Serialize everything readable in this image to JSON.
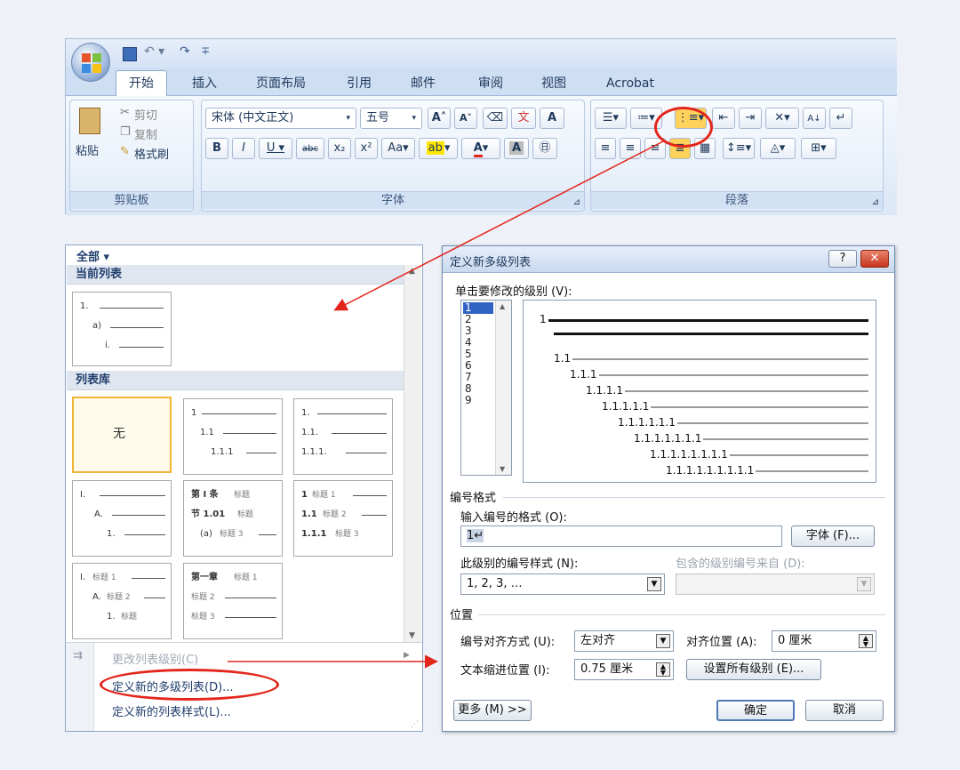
{
  "ribbon": {
    "tabs": [
      "开始",
      "插入",
      "页面布局",
      "引用",
      "邮件",
      "审阅",
      "视图",
      "Acrobat"
    ],
    "active_tab": "开始",
    "clipboard": {
      "paste": "粘贴",
      "cut": "剪切",
      "copy": "复制",
      "format_painter": "格式刷",
      "label": "剪贴板"
    },
    "font": {
      "name": "宋体 (中文正文)",
      "size": "五号",
      "label": "字体"
    },
    "paragraph": {
      "label": "段落"
    }
  },
  "list_panel": {
    "filter": "全部 ▾",
    "current_list_header": "当前列表",
    "library_header": "列表库",
    "none_label": "无",
    "current_tile": [
      "1.",
      "a)",
      "i."
    ],
    "tile2": [
      "1",
      "1.1",
      "1.1.1"
    ],
    "tile3": [
      "1.",
      "1.1.",
      "1.1.1."
    ],
    "tile4": [
      "I.",
      "A.",
      "1."
    ],
    "tile5": [
      "第 I 条",
      "标题",
      "节 1.01",
      "标题",
      "(a)",
      "标题 3"
    ],
    "tile6": [
      "1",
      "标题 1",
      "1.1",
      "标题 2",
      "1.1.1",
      "标题 3"
    ],
    "tile7": [
      "I.",
      "标题 1",
      "A.",
      "标题 2",
      "1.",
      "标题"
    ],
    "tile8": [
      "第一章",
      "标题 1",
      "标题 2",
      "标题 3"
    ],
    "menu": {
      "change_level": "更改列表级别(C)",
      "define_multilevel": "定义新的多级列表(D)...",
      "define_style": "定义新的列表样式(L)..."
    }
  },
  "dialog": {
    "title": "定义新多级列表",
    "help": "?",
    "close": "✕",
    "level_label": "单击要修改的级别 (V):",
    "levels": [
      "1",
      "2",
      "3",
      "4",
      "5",
      "6",
      "7",
      "8",
      "9"
    ],
    "selected_level": "1",
    "preview": [
      "1",
      "1.1",
      "1.1.1",
      "1.1.1.1",
      "1.1.1.1.1",
      "1.1.1.1.1.1",
      "1.1.1.1.1.1.1",
      "1.1.1.1.1.1.1.1",
      "1.1.1.1.1.1.1.1.1"
    ],
    "number_format_section": "编号格式",
    "enter_format_label": "输入编号的格式 (O):",
    "format_value": "1↵",
    "font_button": "字体 (F)...",
    "number_style_label": "此级别的编号样式 (N):",
    "number_style_value": "1, 2, 3, …",
    "include_level_label": "包含的级别编号来自 (D):",
    "position_section": "位置",
    "align_label": "编号对齐方式 (U):",
    "align_value": "左对齐",
    "align_at_label": "对齐位置 (A):",
    "align_at_value": "0 厘米",
    "indent_label": "文本缩进位置 (I):",
    "indent_value": "0.75 厘米",
    "set_all_button": "设置所有级别 (E)...",
    "more_button": "更多 (M) >>",
    "ok_button": "确定",
    "cancel_button": "取消"
  },
  "colors": {
    "annotation_red": "#e3261c",
    "ribbon_blue": "#dfe9f7",
    "dialog_border": "#6f8fb8"
  }
}
